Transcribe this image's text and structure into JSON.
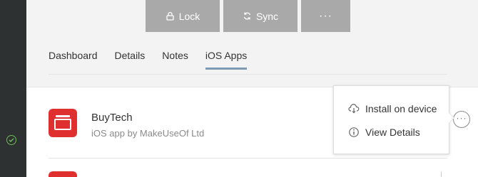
{
  "toolbar": {
    "lock_label": "Lock",
    "sync_label": "Sync",
    "more_label": "···"
  },
  "tabs": [
    {
      "label": "Dashboard",
      "active": false
    },
    {
      "label": "Details",
      "active": false
    },
    {
      "label": "Notes",
      "active": false
    },
    {
      "label": "iOS Apps",
      "active": true
    }
  ],
  "apps": [
    {
      "name": "BuyTech",
      "subtitle": "iOS app by MakeUseOf Ltd",
      "icon_color": "#e02f2f"
    }
  ],
  "row_menu": {
    "button_label": "···",
    "items": [
      {
        "label": "Install on device",
        "icon": "cloud-download-icon"
      },
      {
        "label": "View Details",
        "icon": "info-circle-icon"
      }
    ]
  },
  "colors": {
    "button_gray": "#a9a9a9",
    "tab_underline": "#7e9bb5",
    "app_red": "#e02f2f",
    "sidebar_dark": "#2e3131",
    "check_green": "#6dbb54"
  }
}
